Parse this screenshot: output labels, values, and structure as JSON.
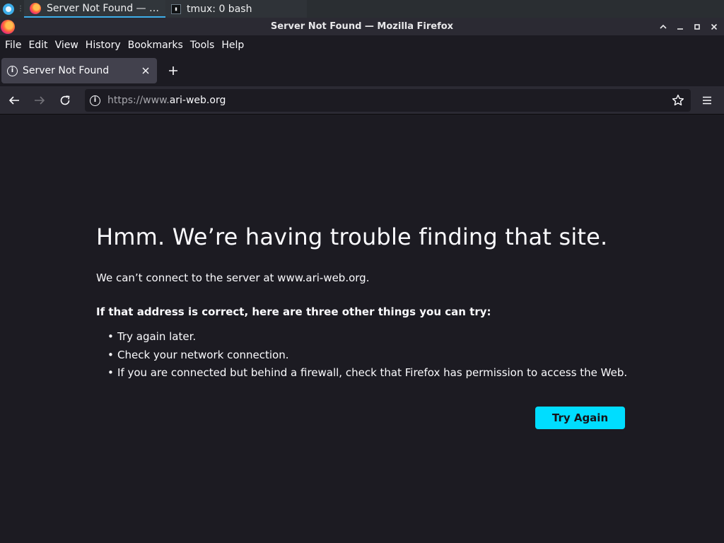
{
  "taskbar": {
    "tasks": [
      {
        "label": "Server Not Found — Mo…",
        "icon": "firefox-icon"
      },
      {
        "label": "tmux: 0 bash",
        "icon": "terminal-icon"
      }
    ]
  },
  "window": {
    "title": "Server Not Found — Mozilla Firefox"
  },
  "menubar": {
    "items": [
      {
        "label": "File"
      },
      {
        "label": "Edit"
      },
      {
        "label": "View"
      },
      {
        "label": "History"
      },
      {
        "label": "Bookmarks"
      },
      {
        "label": "Tools"
      },
      {
        "label": "Help"
      }
    ]
  },
  "tabs": [
    {
      "label": "Server Not Found",
      "active": true
    }
  ],
  "navbar": {
    "url_prefix": "https://www.",
    "url_domain": "ari-web.org"
  },
  "error": {
    "title": "Hmm. We’re having trouble finding that site.",
    "description": "We can’t connect to the server at www.ari-web.org.",
    "tips_title": "If that address is correct, here are three other things you can try:",
    "tips": [
      "Try again later.",
      "Check your network connection.",
      "If you are connected but behind a firewall, check that Firefox has permission to access the Web."
    ],
    "button_label": "Try Again"
  },
  "colors": {
    "accent": "#00ddff",
    "background": "#1c1b22",
    "toolbar": "#2b2a33"
  }
}
